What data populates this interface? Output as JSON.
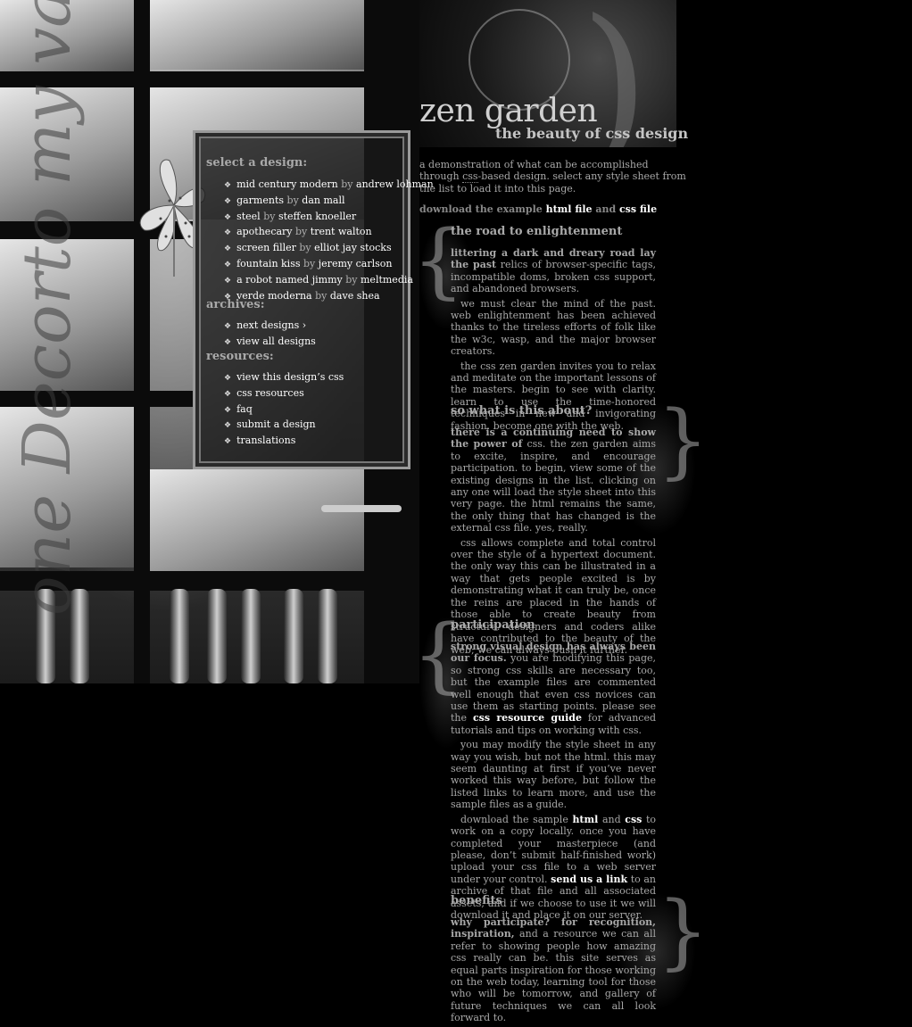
{
  "header": {
    "title": "zen garden",
    "subtitle": "the beauty of css design"
  },
  "summary": {
    "text_before": "a demonstration of what can be accomplished through ",
    "css_abbr": "css",
    "text_after": "-based design. select any style sheet from the list to load it into this page."
  },
  "download": {
    "prefix": "download the example ",
    "html_link": "html file",
    "and": " and ",
    "css_link": "css file"
  },
  "menu": {
    "select_heading": "select a design:",
    "designs": [
      {
        "name": "mid century modern",
        "by": "by",
        "author": "andrew lohman"
      },
      {
        "name": "garments",
        "by": "by",
        "author": "dan mall"
      },
      {
        "name": "steel",
        "by": "by",
        "author": "steffen knoeller"
      },
      {
        "name": "apothecary",
        "by": "by",
        "author": "trent walton"
      },
      {
        "name": "screen filler",
        "by": "by",
        "author": "elliot jay stocks"
      },
      {
        "name": "fountain kiss",
        "by": "by",
        "author": "jeremy carlson"
      },
      {
        "name": "a robot named jimmy",
        "by": "by",
        "author": "meltmedia"
      },
      {
        "name": "verde moderna",
        "by": "by",
        "author": "dave shea"
      }
    ],
    "archives_heading": "archives:",
    "archives": [
      "next designs ›",
      "view all designs"
    ],
    "resources_heading": "resources:",
    "resources": [
      "view this design’s css",
      "css resources",
      "faq",
      "submit a design",
      "translations"
    ]
  },
  "sections": {
    "road": {
      "heading": "the road to enlightenment",
      "p1_lead": "littering a dark and dreary road lay the past",
      "p1_rest": " relics of browser-specific tags, incompatible doms, broken css support, and abandoned browsers.",
      "p2": "we must clear the mind of the past. web enlightenment has been achieved thanks to the tireless efforts of folk like the w3c, wasp, and the major browser creators.",
      "p3": "the css zen garden invites you to relax and meditate on the important lessons of the masters. begin to see with clarity. learn to use the time-honored techniques in new and invigorating fashion. become one with the web."
    },
    "about": {
      "heading": "so what is this about?",
      "p1_lead": "there is a continuing need to show the power of",
      "p1_rest": " css. the zen garden aims to excite, inspire, and encourage participation. to begin, view some of the existing designs in the list. clicking on any one will load the style sheet into this very page. the html remains the same, the only thing that has changed is the external css file. yes, really.",
      "p2": "css allows complete and total control over the style of a hypertext document. the only way this can be illustrated in a way that gets people excited is by demonstrating what it can truly be, once the reins are placed in the hands of those able to create beauty from structure. designers and coders alike have contributed to the beauty of the web; we can always push it further."
    },
    "participation": {
      "heading": "participation",
      "p1_lead": "strong visual design has always been our focus.",
      "p1_rest": " you are modifying this page, so strong css skills are necessary too, but the example files are commented well enough that even css novices can use them as starting points. please see the ",
      "p1_link": "css resource guide",
      "p1_tail": " for advanced tutorials and tips on working with css.",
      "p2": "you may modify the style sheet in any way you wish, but not the html. this may seem daunting at first if you’ve never worked this way before, but follow the listed links to learn more, and use the sample files as a guide.",
      "p3_a": "download the sample ",
      "p3_html": "html",
      "p3_and": " and ",
      "p3_css": "css",
      "p3_b": " to work on a copy locally. once you have completed your masterpiece (and please, don’t submit half-finished work) upload your css file to a web server under your control. ",
      "p3_link": "send us a link",
      "p3_c": " to an archive of that file and all associated assets, and if we choose to use it we will download it and place it on our server."
    },
    "benefits": {
      "heading": "benefits",
      "p1_lead": "why participate? for recognition, inspiration,",
      "p1_rest": " and a resource we can all refer to showing people how amazing css really can be. this site serves as equal parts inspiration for those working on the web today, learning tool for those who will be tomorrow, and gallery of future techniques we can all look forward to."
    }
  },
  "decor": {
    "script_text": "one Decorto my valley",
    "brace_open": "{",
    "brace_close": "}",
    "bullet": "❖"
  }
}
